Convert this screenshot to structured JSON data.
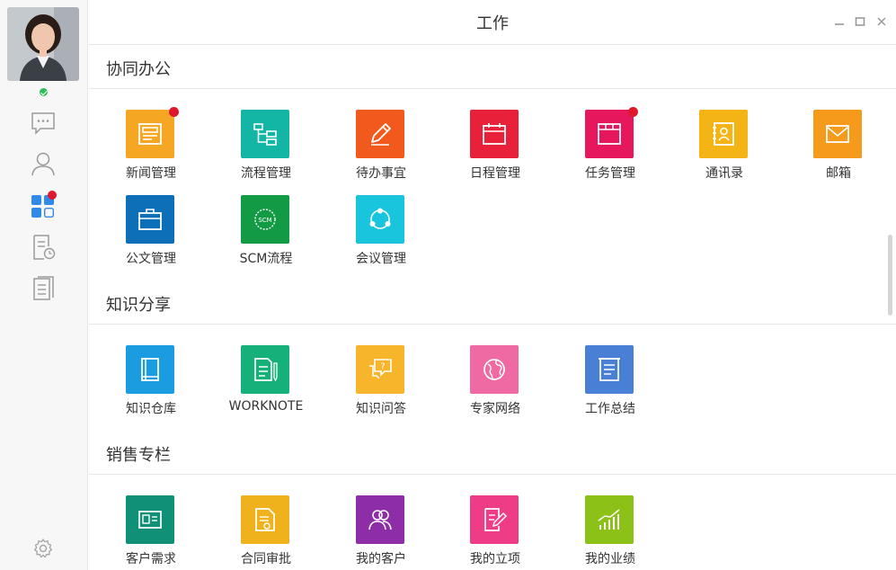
{
  "window": {
    "title": "工作"
  },
  "sidebar": {
    "icons": [
      "chat-icon",
      "contacts-icon",
      "apps-icon",
      "history-doc-icon",
      "documents-icon",
      "settings-icon"
    ]
  },
  "sections": [
    {
      "title": "协同办公",
      "apps": [
        {
          "label": "新闻管理",
          "color": "#f5a623",
          "badge": true
        },
        {
          "label": "流程管理",
          "color": "#13b5a5",
          "badge": false
        },
        {
          "label": "待办事宜",
          "color": "#f2591d",
          "badge": false
        },
        {
          "label": "日程管理",
          "color": "#e8203a",
          "badge": false
        },
        {
          "label": "任务管理",
          "color": "#e6175c",
          "badge": true
        },
        {
          "label": "通讯录",
          "color": "#f5b415",
          "badge": false
        },
        {
          "label": "邮箱",
          "color": "#f59a1b",
          "badge": false
        },
        {
          "label": "公文管理",
          "color": "#0d6fb8",
          "badge": false
        },
        {
          "label": "SCM流程",
          "color": "#129a44",
          "badge": false
        },
        {
          "label": "会议管理",
          "color": "#19c5dd",
          "badge": false
        }
      ]
    },
    {
      "title": "知识分享",
      "apps": [
        {
          "label": "知识仓库",
          "color": "#1b9ce0",
          "badge": false
        },
        {
          "label": "WORKNOTE",
          "color": "#16b07a",
          "badge": false
        },
        {
          "label": "知识问答",
          "color": "#f6b52a",
          "badge": false
        },
        {
          "label": "专家网络",
          "color": "#ef6aa2",
          "badge": false
        },
        {
          "label": "工作总结",
          "color": "#4a7fd6",
          "badge": false
        }
      ]
    },
    {
      "title": "销售专栏",
      "apps": [
        {
          "label": "客户需求",
          "color": "#119078",
          "badge": false
        },
        {
          "label": "合同审批",
          "color": "#f0b21c",
          "badge": false
        },
        {
          "label": "我的客户",
          "color": "#8d2ea8",
          "badge": false
        },
        {
          "label": "我的立项",
          "color": "#ef3c86",
          "badge": false
        },
        {
          "label": "我的业绩",
          "color": "#8cc118",
          "badge": false
        }
      ]
    }
  ]
}
